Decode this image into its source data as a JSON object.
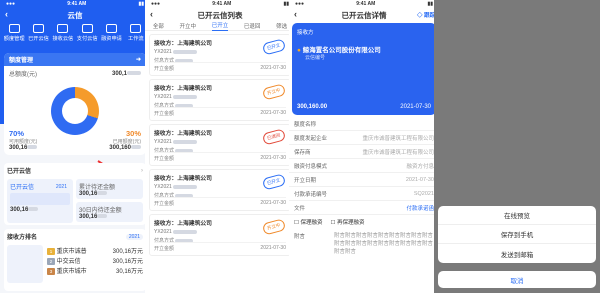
{
  "status": {
    "time": "9:41 AM"
  },
  "p1": {
    "title": "云信",
    "icons": [
      {
        "name": "额度管理",
        "icon": "quota-icon"
      },
      {
        "name": "已开云信",
        "icon": "issued-icon"
      },
      {
        "name": "接收云信",
        "icon": "receive-icon"
      },
      {
        "name": "支付云信",
        "icon": "pay-icon"
      },
      {
        "name": "融资申请",
        "icon": "finance-icon"
      },
      {
        "name": "工作流",
        "icon": "workflow-icon"
      }
    ],
    "quota": {
      "header": "额度管理",
      "total_label": "总额度(元)",
      "total": "300,1",
      "pct_left": "70%",
      "pct_right": "30%",
      "used_label": "可用额度(元)",
      "left_amount": "300,16",
      "right_label": "已用额度(元)",
      "right_amount": "300,160"
    },
    "issued": {
      "label": "已开云信",
      "count_label": "已开云信",
      "year": "2021",
      "amount": "300,16",
      "side1": "累计待还金额",
      "side1_amount": "300,16",
      "side2": "30日内待还金额",
      "side2_amount": "300,16"
    },
    "recv": {
      "label": "接收方排名",
      "year": "2021",
      "rows": [
        {
          "rank": "1",
          "name": "重庆市诚普",
          "amt": "300,16万元",
          "color": "#e8b13a"
        },
        {
          "rank": "2",
          "name": "中交云信",
          "amt": "300,16万元",
          "color": "#9aa6b8"
        },
        {
          "rank": "3",
          "name": "重庆市城市",
          "amt": "30,16万元",
          "color": "#c98548"
        }
      ]
    }
  },
  "p2": {
    "title": "已开云信列表",
    "tabs": [
      "全部",
      "开立中",
      "已开立",
      "已退回",
      "筛选"
    ],
    "items": [
      {
        "title": "接收方：上海建筑公司",
        "code": "YX2021",
        "line2": "付息方式",
        "stamp": "已开立",
        "stamp_color": "#2b6ef5",
        "date": "2021-07-30",
        "amount": "开立金额"
      },
      {
        "title": "接收方：上海建筑公司",
        "code": "YX2021",
        "line2": "付息方式",
        "stamp": "开立中",
        "stamp_color": "#f08a2b",
        "date": "2021-07-30",
        "amount": "开立金额"
      },
      {
        "title": "接收方：上海建筑公司",
        "code": "YX2021",
        "line2": "付息方式",
        "stamp": "已退回",
        "stamp_color": "#e24b3b",
        "date": "2021-07-30",
        "amount": "开立金额"
      },
      {
        "title": "接收方：上海建筑公司",
        "code": "YX2021",
        "line2": "付息方式",
        "stamp": "已开立",
        "stamp_color": "#2b6ef5",
        "date": "2021-07-30",
        "amount": "开立金额"
      },
      {
        "title": "接收方：上海建筑公司",
        "code": "YX2021",
        "line2": "付息方式",
        "stamp": "开立中",
        "stamp_color": "#f08a2b",
        "date": "2021-07-30",
        "amount": "开立金额"
      }
    ]
  },
  "p3": {
    "title": "已开云信详情",
    "action": "◇ 跟踪",
    "card": {
      "label": "接收方",
      "company": "鲸海置名公司股份有限公司",
      "sub": "云信编号",
      "amount": "300,160.00",
      "date": "2021-07-30"
    },
    "fields": [
      {
        "k": "额度名称",
        "v": ""
      },
      {
        "k": "额度发起企业",
        "v": "重庆市诚普建筑工程有限公司"
      },
      {
        "k": "保存商",
        "v": "重庆市诚普建筑工程有限公司"
      },
      {
        "k": "融资付息模式",
        "v": "融资方付息"
      },
      {
        "k": "开立日期",
        "v": "2021-07-30"
      },
      {
        "k": "付款承诺编号",
        "v": "SQ2021"
      },
      {
        "k": "文件",
        "v": "付款承诺函"
      }
    ],
    "checks": [
      "保理融资",
      "再保理融资"
    ],
    "note_label": "附言",
    "note": "附言附言附言附言附言附言附言附言附言附言附言附言附言附言附言附言附言附言附言附言"
  },
  "p4": {
    "options": [
      "在线预览",
      "保存到手机",
      "发送到邮箱"
    ],
    "cancel": "取消"
  }
}
